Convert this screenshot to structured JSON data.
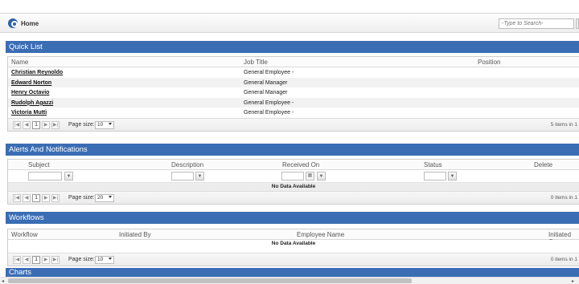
{
  "topbar": {
    "home_label": "Home",
    "search_placeholder": "-Type to Search-"
  },
  "pager": {
    "first": "|◀",
    "prev": "◀",
    "page": "1",
    "next": "▶",
    "last": "▶|",
    "size_label": "Page size:"
  },
  "quick_list": {
    "title": "Quick List",
    "columns": [
      "Name",
      "Job Title",
      "Position"
    ],
    "rows": [
      {
        "name": "Christian Reynoldo",
        "job": "General Employee -"
      },
      {
        "name": "Edward Norton",
        "job": "General Manager"
      },
      {
        "name": "Henry Octavio",
        "job": "General Manager"
      },
      {
        "name": "Rudolph Agazzi",
        "job": "General Employee -"
      },
      {
        "name": "Victoria Mutti",
        "job": "General Employee -"
      }
    ],
    "page_size": "10",
    "info": "5 items in 1"
  },
  "alerts": {
    "title": "Alerts And Notifications",
    "columns": [
      "Subject",
      "Description",
      "Received On",
      "Status",
      "Delete"
    ],
    "no_data": "No Data Available",
    "page_size": "20",
    "info": "0 items in 1"
  },
  "workflows": {
    "title": "Workflows",
    "columns": [
      "Workflow",
      "Initiated By",
      "Employee Name",
      "Initiated On"
    ],
    "no_data": "No Data Available",
    "page_size": "10",
    "info": "0 items in 1"
  },
  "charts": {
    "title": "Charts"
  },
  "icons": {
    "filter": "filter-icon",
    "calendar": "calendar-icon",
    "home": "refresh-home-icon"
  },
  "colors": {
    "panel_header": "#3a6db4",
    "alt_row": "#f2f2f2"
  }
}
